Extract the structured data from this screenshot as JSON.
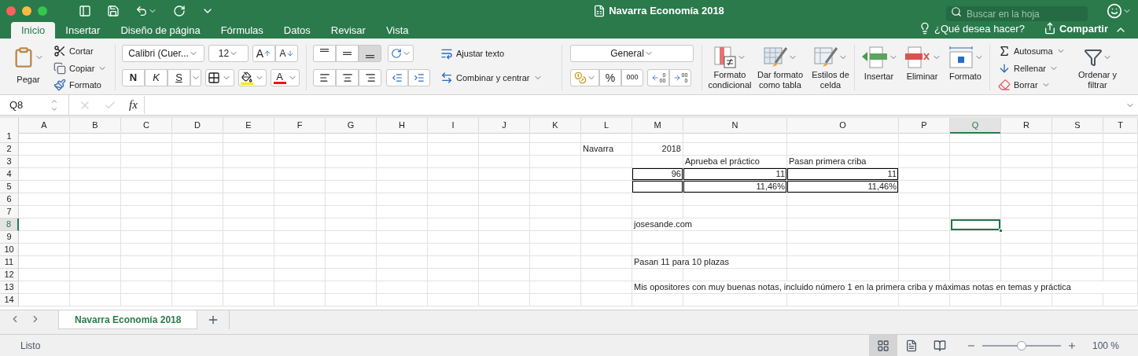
{
  "window": {
    "title": "Navarra Economía 2018",
    "search_placeholder": "Buscar en la hoja"
  },
  "ribbon_tabs": [
    {
      "label": "Inicio",
      "selected": true
    },
    {
      "label": "Insertar",
      "selected": false
    },
    {
      "label": "Diseño de página",
      "selected": false
    },
    {
      "label": "Fórmulas",
      "selected": false
    },
    {
      "label": "Datos",
      "selected": false
    },
    {
      "label": "Revisar",
      "selected": false
    },
    {
      "label": "Vista",
      "selected": false
    }
  ],
  "tell_me": "¿Qué desea hacer?",
  "share": "Compartir",
  "clipboard": {
    "paste": "Pegar",
    "cut": "Cortar",
    "copy": "Copiar",
    "format_painter": "Formato"
  },
  "font": {
    "name": "Calibri (Cuer...",
    "size": "12",
    "grow": "A",
    "shrink": "A",
    "bold": "N",
    "italic": "K",
    "underline": "S",
    "font_color": "A"
  },
  "alignment": {
    "wrap_text": "Ajustar texto",
    "merge": "Combinar y centrar",
    "vertical": [
      {
        "kind": "top",
        "selected": false
      },
      {
        "kind": "middle",
        "selected": false
      },
      {
        "kind": "bottom",
        "selected": true
      }
    ]
  },
  "number": {
    "format": "General",
    "percent": "%",
    "thousands": "000",
    "increase_decimal": [
      "0",
      "00"
    ],
    "decrease_decimal": [
      "00",
      "0"
    ]
  },
  "styles": [
    {
      "kind": "conditional",
      "label": "Formato condicional"
    },
    {
      "kind": "table",
      "label": "Dar formato como tabla"
    },
    {
      "kind": "cell_styles",
      "label": "Estilos de celda"
    }
  ],
  "cells_group": [
    {
      "kind": "insert",
      "label": "Insertar"
    },
    {
      "kind": "delete",
      "label": "Eliminar"
    },
    {
      "kind": "format",
      "label": "Formato"
    }
  ],
  "editing": {
    "autosum": "Autosuma",
    "fill": "Rellenar",
    "clear": "Borrar",
    "sort_filter": "Ordenar y filtrar"
  },
  "formula_bar": {
    "name_box": "Q8",
    "function_label": "fx"
  },
  "columns": [
    {
      "label": "A",
      "selected": false
    },
    {
      "label": "B",
      "selected": false
    },
    {
      "label": "C",
      "selected": false
    },
    {
      "label": "D",
      "selected": false
    },
    {
      "label": "E",
      "selected": false
    },
    {
      "label": "F",
      "selected": false
    },
    {
      "label": "G",
      "selected": false
    },
    {
      "label": "H",
      "selected": false
    },
    {
      "label": "I",
      "selected": false
    },
    {
      "label": "J",
      "selected": false
    },
    {
      "label": "K",
      "selected": false
    },
    {
      "label": "L",
      "selected": false
    },
    {
      "label": "M",
      "selected": false
    },
    {
      "label": "N",
      "selected": false
    },
    {
      "label": "O",
      "selected": false
    },
    {
      "label": "P",
      "selected": false
    },
    {
      "label": "Q",
      "selected": true
    },
    {
      "label": "R",
      "selected": false
    },
    {
      "label": "S",
      "selected": false
    },
    {
      "label": "T",
      "selected": false
    }
  ],
  "rows": [
    {
      "number": "1",
      "selected": false
    },
    {
      "number": "2",
      "selected": false,
      "cells": {
        "L": {
          "text": "Navarra",
          "kind": "text",
          "boxed": false,
          "selected": false
        },
        "M": {
          "text": "2018",
          "kind": "number",
          "boxed": false,
          "selected": false
        }
      }
    },
    {
      "number": "3",
      "selected": false,
      "cells": {
        "N": {
          "text": "Aprueba el práctico",
          "kind": "text",
          "boxed": false,
          "selected": false
        },
        "O": {
          "text": "Pasan primera criba",
          "kind": "text",
          "boxed": false,
          "selected": false
        }
      }
    },
    {
      "number": "4",
      "selected": false,
      "cells": {
        "M": {
          "text": "96",
          "kind": "number",
          "boxed": true,
          "selected": false
        },
        "N": {
          "text": "11",
          "kind": "number",
          "boxed": true,
          "selected": false
        },
        "O": {
          "text": "11",
          "kind": "number",
          "boxed": true,
          "selected": false
        }
      }
    },
    {
      "number": "5",
      "selected": false,
      "cells": {
        "M": {
          "boxed": true,
          "selected": false
        },
        "N": {
          "text": "11,46%",
          "kind": "number",
          "boxed": true,
          "selected": false
        },
        "O": {
          "text": "11,46%",
          "kind": "number",
          "boxed": true,
          "selected": false
        }
      }
    },
    {
      "number": "6",
      "selected": false
    },
    {
      "number": "7",
      "selected": false
    },
    {
      "number": "8",
      "selected": true,
      "cells": {
        "M": {
          "text": "josesande.com",
          "kind": "text",
          "boxed": false,
          "selected": false
        },
        "Q": {
          "boxed": false,
          "selected": true
        }
      }
    },
    {
      "number": "9",
      "selected": false
    },
    {
      "number": "10",
      "selected": false
    },
    {
      "number": "11",
      "selected": false,
      "cells": {
        "M": {
          "text": "Pasan 11 para 10 plazas",
          "kind": "text",
          "boxed": false,
          "selected": false
        }
      }
    },
    {
      "number": "12",
      "selected": false
    },
    {
      "number": "13",
      "selected": false,
      "cells": {
        "M": {
          "text": "Mis opositores con muy buenas notas, incluido número 1 en la primera criba y máximas notas en temas y práctica",
          "kind": "text",
          "boxed": false,
          "selected": false
        }
      }
    },
    {
      "number": "14",
      "selected": false
    }
  ],
  "sheet_tabs": [
    {
      "label": "Navarra Economía 2018",
      "selected": true
    }
  ],
  "status_bar": {
    "status": "Listo",
    "views": [
      {
        "kind": "normal",
        "selected": true
      },
      {
        "kind": "page_layout",
        "selected": false
      },
      {
        "kind": "page_break",
        "selected": false
      }
    ],
    "zoom": {
      "level": 0.5,
      "reading": "100 %"
    }
  }
}
